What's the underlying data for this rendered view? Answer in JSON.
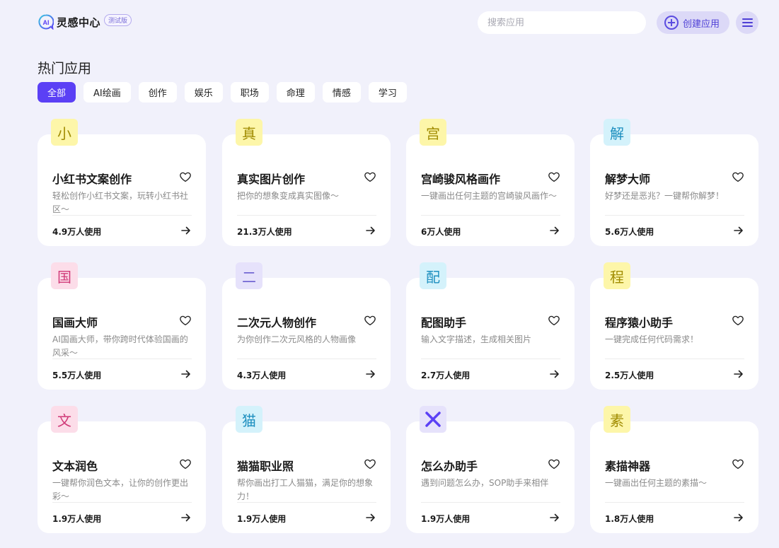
{
  "header": {
    "logo_icon": "ai-logo-icon",
    "logo_text": "AI",
    "title": "灵感中心",
    "badge": "测试版",
    "search_placeholder": "搜索应用",
    "create_label": "创建应用",
    "accent": "#5b40f5"
  },
  "section_title": "热门应用",
  "tabs": [
    {
      "label": "全部",
      "active": true
    },
    {
      "label": "AI绘画"
    },
    {
      "label": "创作"
    },
    {
      "label": "娱乐"
    },
    {
      "label": "职场"
    },
    {
      "label": "命理"
    },
    {
      "label": "情感"
    },
    {
      "label": "学习"
    }
  ],
  "cards": [
    {
      "icon_char": "小",
      "icon_bg": "#fdf6a9",
      "icon_color": "#a08b00",
      "title": "小红书文案创作",
      "desc": "轻松创作小红书文案，玩转小红书社区～",
      "usage": "4.9万人使用"
    },
    {
      "icon_char": "真",
      "icon_bg": "#fdf6a9",
      "icon_color": "#a08b00",
      "title": "真实图片创作",
      "desc": "把你的想象变成真实图像～",
      "usage": "21.3万人使用"
    },
    {
      "icon_char": "宫",
      "icon_bg": "#fdf6a9",
      "icon_color": "#a08b00",
      "title": "宫崎骏风格画作",
      "desc": "一键画出任何主题的宫崎骏风画作～",
      "usage": "6万人使用"
    },
    {
      "icon_char": "解",
      "icon_bg": "#d4f2fb",
      "icon_color": "#1d8fbf",
      "title": "解梦大师",
      "desc": "好梦还是恶兆？一键帮你解梦！",
      "usage": "5.6万人使用"
    },
    {
      "icon_char": "国",
      "icon_bg": "#fcdde9",
      "icon_color": "#d03a78",
      "title": "国画大师",
      "desc": "AI国画大师，带你跨时代体验国画的风采～",
      "usage": "5.5万人使用"
    },
    {
      "icon_char": "二",
      "icon_bg": "#e6e2fb",
      "icon_color": "#6a5fd0",
      "title": "二次元人物创作",
      "desc": "为你创作二次元风格的人物画像",
      "usage": "4.3万人使用"
    },
    {
      "icon_char": "配",
      "icon_bg": "#d4f2fb",
      "icon_color": "#1d8fbf",
      "title": "配图助手",
      "desc": "输入文字描述，生成相关图片",
      "usage": "2.7万人使用"
    },
    {
      "icon_char": "程",
      "icon_bg": "#fdf6a9",
      "icon_color": "#a08b00",
      "title": "程序猿小助手",
      "desc": "一键完成任何代码需求！",
      "usage": "2.5万人使用"
    },
    {
      "icon_char": "文",
      "icon_bg": "#fcdde9",
      "icon_color": "#d03a78",
      "title": "文本润色",
      "desc": "一键帮你润色文本，让你的创作更出彩～",
      "usage": "1.9万人使用"
    },
    {
      "icon_char": "猫",
      "icon_bg": "#d4f2fb",
      "icon_color": "#1d8fbf",
      "title": "猫猫职业照",
      "desc": "帮你画出打工人猫猫，满足你的想象力！",
      "usage": "1.9万人使用"
    },
    {
      "icon_char": "",
      "icon_name": "cross-icon",
      "icon_bg": "#e6e2fb",
      "icon_color": "#5b40f5",
      "title": "怎么办助手",
      "desc": "遇到问题怎么办，SOP助手来相伴",
      "usage": "1.9万人使用"
    },
    {
      "icon_char": "素",
      "icon_bg": "#fdf6a9",
      "icon_color": "#a08b00",
      "title": "素描神器",
      "desc": "一键画出任何主题的素描～",
      "usage": "1.8万人使用"
    }
  ]
}
